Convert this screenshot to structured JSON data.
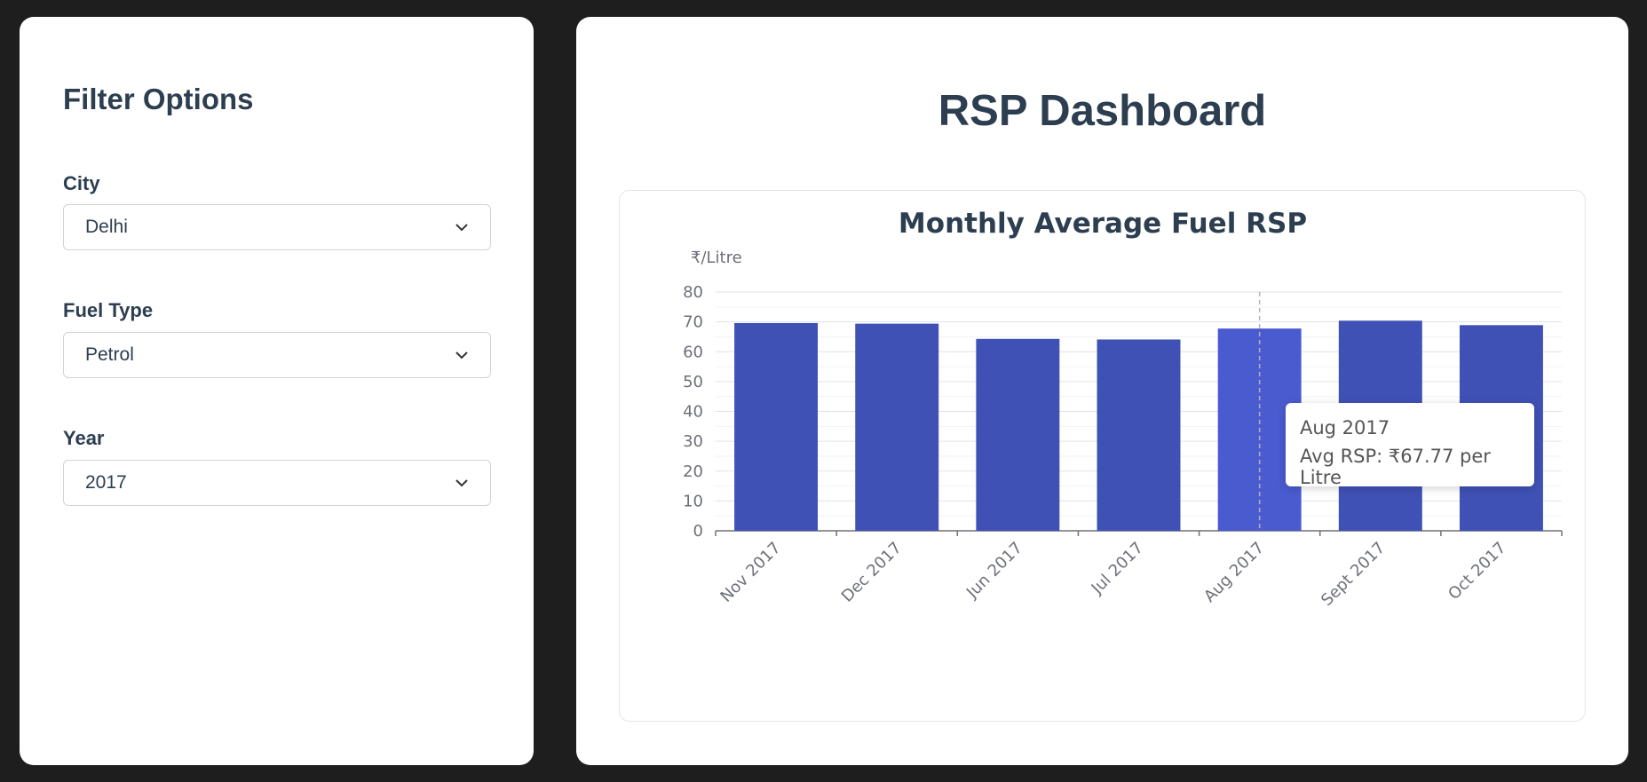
{
  "sidebar": {
    "title": "Filter Options",
    "filters": [
      {
        "label": "City",
        "value": "Delhi"
      },
      {
        "label": "Fuel Type",
        "value": "Petrol"
      },
      {
        "label": "Year",
        "value": "2017"
      }
    ]
  },
  "main": {
    "title": "RSP Dashboard"
  },
  "tooltip": {
    "title": "Aug 2017",
    "line": "Avg RSP: ₹67.77 per Litre"
  },
  "colors": {
    "bar": "#3f51b5",
    "bar_highlight": "#4a5bd0",
    "axis_text": "#6e7079"
  },
  "chart_data": {
    "type": "bar",
    "title": "Monthly Average Fuel RSP",
    "ylabel": "₹/Litre",
    "xlabel": "",
    "categories": [
      "Nov 2017",
      "Dec 2017",
      "Jun 2017",
      "Jul 2017",
      "Aug 2017",
      "Sept 2017",
      "Oct 2017"
    ],
    "values": [
      69.6,
      69.4,
      64.3,
      64.1,
      67.77,
      70.4,
      68.9
    ],
    "ylim": [
      0,
      80
    ],
    "yticks": [
      0,
      10,
      20,
      30,
      40,
      50,
      60,
      70,
      80
    ],
    "grid": true,
    "highlighted_category": "Aug 2017"
  }
}
